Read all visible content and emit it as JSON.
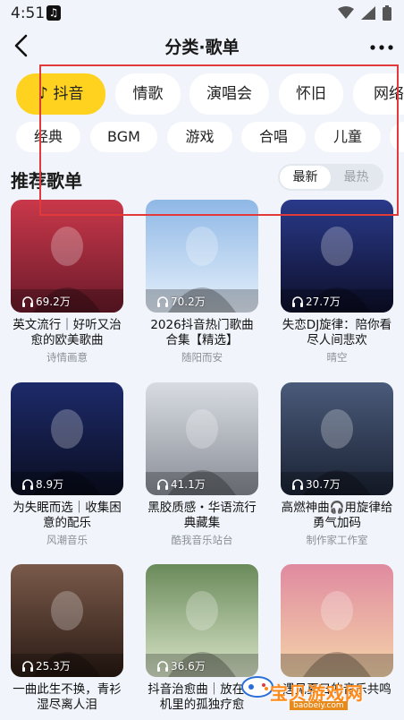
{
  "status_bar": {
    "time": "4:51"
  },
  "header": {
    "title": "分类·歌单"
  },
  "categories_row1": [
    "抖音",
    "情歌",
    "演唱会",
    "怀旧",
    "网络"
  ],
  "categories_row2": [
    "经典",
    "BGM",
    "游戏",
    "合唱",
    "儿童"
  ],
  "active_category": "抖音",
  "section": {
    "title": "推荐歌单",
    "sort_options": [
      "最新",
      "最热"
    ],
    "sort_selected": "最新"
  },
  "playlists": [
    {
      "title": "英文流行｜好听又治愈的欧美歌曲",
      "author": "诗情画意",
      "plays": "69.2万"
    },
    {
      "title": "2026抖音热门歌曲合集【精选】",
      "author": "随阳而安",
      "plays": "70.2万"
    },
    {
      "title": "失恋DJ旋律：陪你看尽人间悲欢",
      "author": "晴空",
      "plays": "27.7万"
    },
    {
      "title": "为失眠而选｜收集困意的配乐",
      "author": "风潮音乐",
      "plays": "8.9万"
    },
    {
      "title": "黑胶质感・华语流行典藏集",
      "author": "酷我音乐站台",
      "plays": "41.1万"
    },
    {
      "title": "高燃神曲🎧用旋律给勇气加码",
      "author": "制作家工作室",
      "plays": "30.7万"
    },
    {
      "title": "一曲此生不换，青衫湿尽离人泪",
      "author": "",
      "plays": "25.3万"
    },
    {
      "title": "抖音治愈曲｜放在耳机里的孤独疗愈",
      "author": "",
      "plays": "36.6万"
    },
    {
      "title": "遇见夏日的音乐共鸣",
      "author": "",
      "plays": ""
    }
  ],
  "watermark": {
    "text": "宝贝游戏网",
    "url": "baobeiy.com"
  },
  "colors": {
    "accent": "#ffd21f",
    "background": "#f1f5fb",
    "highlight_box": "#e23a3a"
  }
}
